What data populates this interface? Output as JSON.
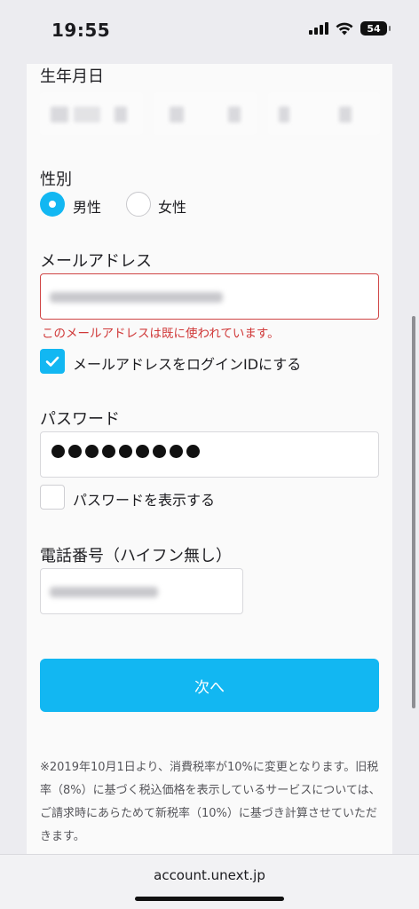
{
  "status_bar": {
    "time": "19:55",
    "battery": "54"
  },
  "form": {
    "birthdate_label": "生年月日",
    "gender_label": "性別",
    "gender_options": [
      {
        "label": "男性",
        "selected": true
      },
      {
        "label": "女性",
        "selected": false
      }
    ],
    "email_label": "メールアドレス",
    "email_error": "このメールアドレスは既に使われています。",
    "email_as_login_label": "メールアドレスをログインIDにする",
    "email_as_login_checked": true,
    "password_label": "パスワード",
    "show_password_label": "パスワードを表示する",
    "show_password_checked": false,
    "phone_label": "電話番号（ハイフン無し）",
    "next_button": "次へ"
  },
  "tax_note": "※2019年10月1日より、消費税率が10%に変更となります。旧税率（8%）に基づく税込価格を表示しているサービスについては、ご請求時にあらためて新税率（10%）に基づき計算させていただきます。",
  "browser": {
    "url": "account.unext.jp"
  },
  "colors": {
    "accent": "#12b7f2",
    "error": "#d03838"
  }
}
